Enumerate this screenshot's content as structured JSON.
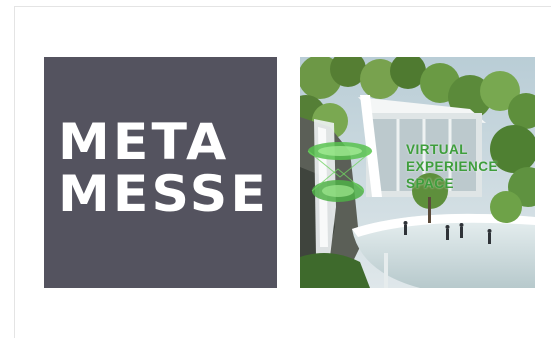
{
  "logo": {
    "line1": "META",
    "line2": "MESSE",
    "background": "#54535f",
    "text_color": "#ffffff"
  },
  "space": {
    "line1": "VIRTUAL",
    "line2": "EXPERIENCE",
    "line3": "SPACE",
    "accent": "#3e9e3c"
  }
}
